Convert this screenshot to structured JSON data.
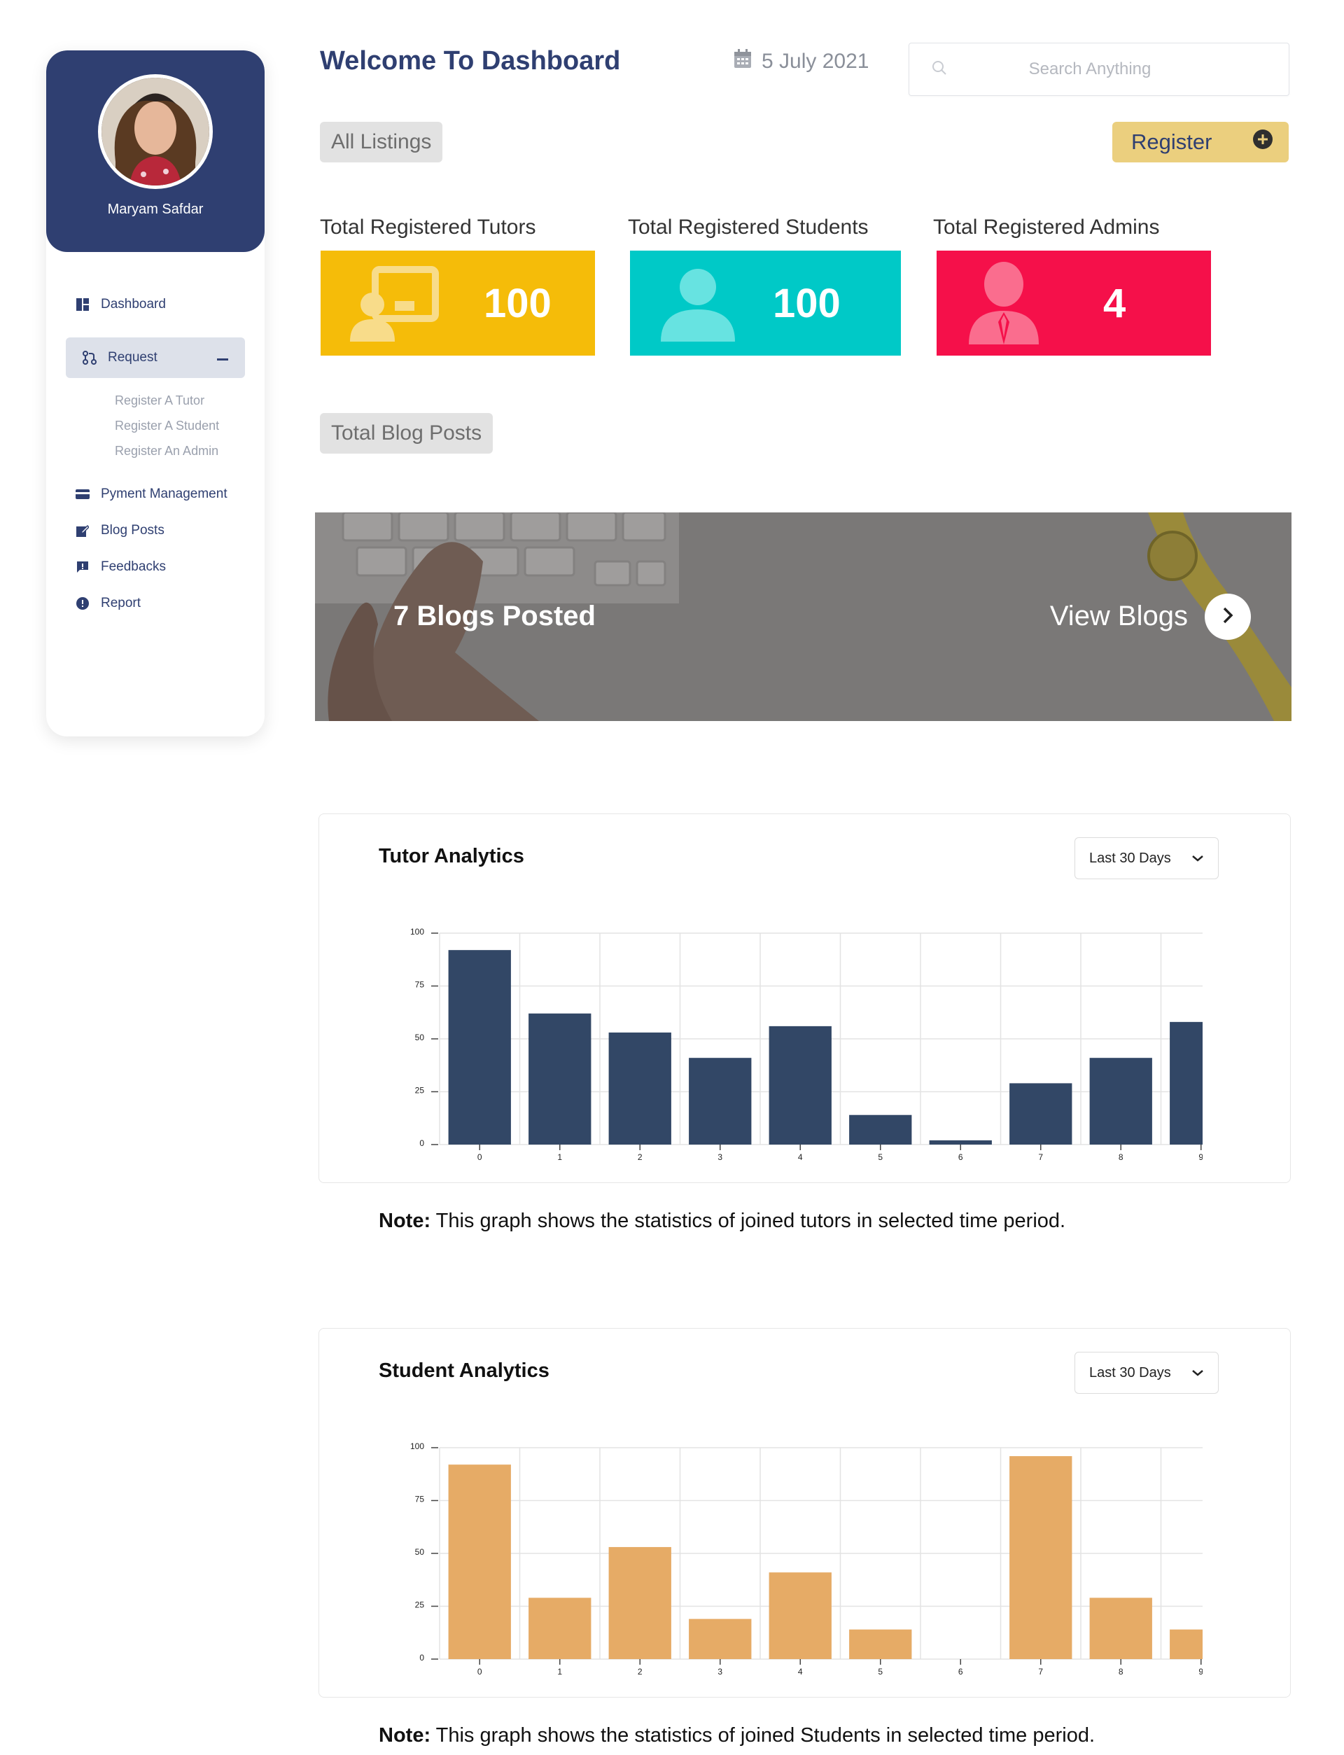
{
  "sidebar": {
    "user_name": "Maryam Safdar",
    "items": [
      {
        "label": "Dashboard",
        "icon": "dashboard-icon"
      },
      {
        "label": "Request",
        "icon": "git-request-icon"
      },
      {
        "label": "Pyment Management",
        "icon": "credit-card-icon"
      },
      {
        "label": "Blog Posts",
        "icon": "edit-icon"
      },
      {
        "label": "Feedbacks",
        "icon": "feedback-icon"
      },
      {
        "label": "Report",
        "icon": "alert-circle-icon"
      }
    ],
    "request_sub": [
      "Register A Tutor",
      "Register A Student",
      "Register An Admin"
    ],
    "active_item": "Request"
  },
  "header": {
    "title": "Welcome To Dashboard",
    "date": "5 July 2021",
    "search_placeholder": "Search Anything"
  },
  "listings_label": "All Listings",
  "register_label": "Register",
  "stats": [
    {
      "label": "Total Registered Tutors",
      "value": "100",
      "color": "#f5bc09",
      "icon": "tutor-board-icon"
    },
    {
      "label": "Total Registered Students",
      "value": "100",
      "color": "#00c9c7",
      "icon": "student-icon"
    },
    {
      "label": "Total Registered Admins",
      "value": "4",
      "color": "#f5104a",
      "icon": "admin-icon"
    }
  ],
  "blog_posts_label": "Total Blog Posts",
  "banner": {
    "text": "7 Blogs Posted",
    "link": "View Blogs"
  },
  "analytics": [
    {
      "title": "Tutor Analytics",
      "period": "Last 30 Days",
      "note_prefix": "Note:",
      "note": " This graph shows the statistics of joined tutors in selected time period."
    },
    {
      "title": "Student Analytics",
      "period": "Last 30 Days",
      "note_prefix": "Note:",
      "note": " This graph shows the statistics of joined Students in selected time period."
    }
  ],
  "chart_data": [
    {
      "type": "bar",
      "categories": [
        "0",
        "1",
        "2",
        "3",
        "4",
        "5",
        "6",
        "7",
        "8",
        "9"
      ],
      "values": [
        92,
        62,
        53,
        41,
        56,
        14,
        2,
        29,
        41,
        58
      ],
      "ylim": [
        0,
        100
      ],
      "yticks": [
        "0",
        "25",
        "50",
        "75",
        "100"
      ],
      "color": "#324766",
      "grid": true
    },
    {
      "type": "bar",
      "categories": [
        "0",
        "1",
        "2",
        "3",
        "4",
        "5",
        "6",
        "7",
        "8",
        "9"
      ],
      "values": [
        92,
        29,
        53,
        19,
        41,
        14,
        0,
        96,
        29,
        14
      ],
      "ylim": [
        0,
        100
      ],
      "yticks": [
        "0",
        "25",
        "50",
        "75",
        "100"
      ],
      "color": "#e6ab66",
      "grid": true
    }
  ]
}
